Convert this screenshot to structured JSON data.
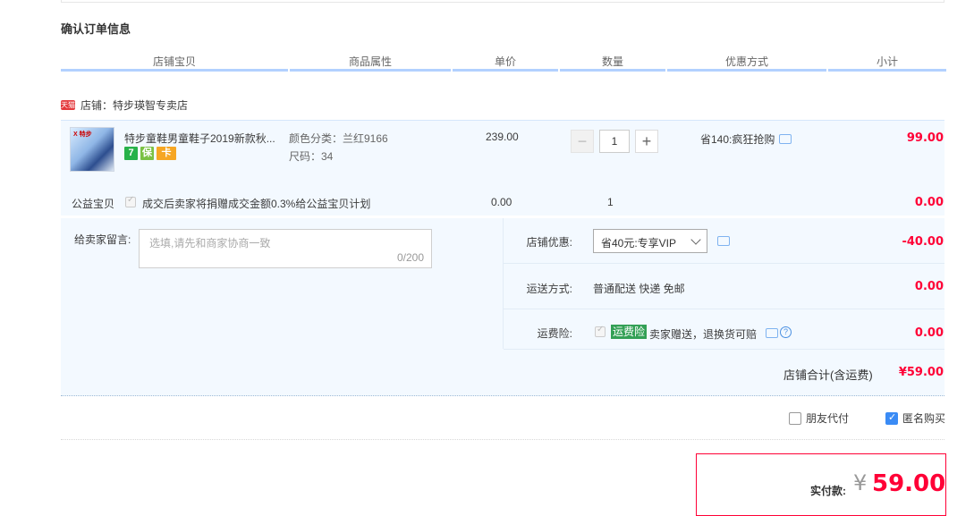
{
  "section_title": "确认订单信息",
  "columns": [
    "店铺宝贝",
    "商品属性",
    "单价",
    "数量",
    "优惠方式",
    "小计"
  ],
  "shop": {
    "badge": "天猫",
    "label": "店铺：",
    "name": "特步瑛智专卖店"
  },
  "item": {
    "thumb_brand": "X 特步",
    "title": "特步童鞋男童鞋子2019新款秋...",
    "badges": [
      "7",
      "保",
      "卡"
    ],
    "attr_color": "颜色分类：兰红9166",
    "attr_size": "尺码：34",
    "unit_price": "239.00",
    "qty_minus": "−",
    "qty_value": "1",
    "qty_plus": "+",
    "promo": "省140:疯狂抢购",
    "subtotal": "99.00"
  },
  "charity": {
    "label": "公益宝贝",
    "text": "成交后卖家将捐赠成交金额0.3%给公益宝贝计划",
    "price": "0.00",
    "qty": "1",
    "subtotal": "0.00"
  },
  "message": {
    "label": "给卖家留言:",
    "placeholder": "选填,请先和商家协商一致",
    "count": "0/200"
  },
  "shop_discount": {
    "label": "店铺优惠:",
    "selected": "省40元:专享VIP",
    "amount": "-40.00"
  },
  "shipping": {
    "label": "运送方式:",
    "value": "普通配送 快递 免邮",
    "amount": "0.00"
  },
  "insurance": {
    "label": "运费险:",
    "tag": "运费险",
    "text": "卖家赠送，退换货可赔",
    "help": "?",
    "amount": "0.00"
  },
  "shop_total": {
    "label": "店铺合计(含运费)",
    "value": "¥59.00"
  },
  "options": {
    "friend_pay": "朋友代付",
    "anonymous": "匿名购买"
  },
  "payment": {
    "label": "实付款:",
    "currency": "¥",
    "amount": "59.00"
  },
  "colors": {
    "accent_red": "#ff0036",
    "header_line": "#b2d1ff",
    "row_bg": "#f3f9ff",
    "checkbox_blue": "#3a8bf5"
  }
}
